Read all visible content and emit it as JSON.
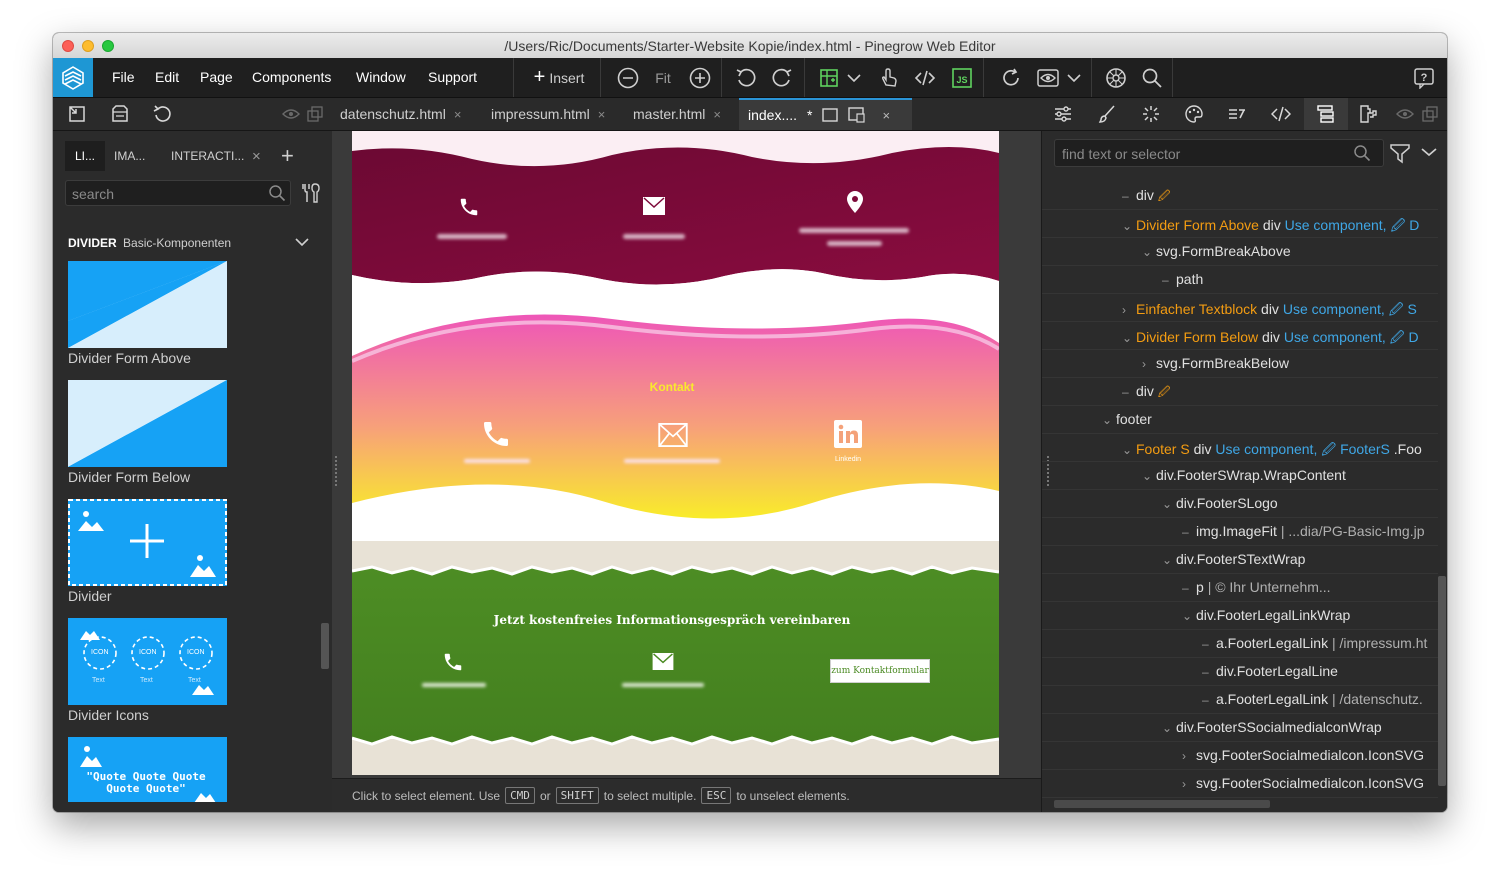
{
  "window": {
    "title": "/Users/Ric/Documents/Starter-Website Kopie/index.html - Pinegrow Web Editor"
  },
  "menu": {
    "items": [
      "File",
      "Edit",
      "Page",
      "Components",
      "Window",
      "Support"
    ]
  },
  "toolbar": {
    "insert_label": "Insert",
    "fit_label": "Fit"
  },
  "tabs": [
    {
      "label": "datenschutz.html",
      "close": "×"
    },
    {
      "label": "impressum.html",
      "close": "×"
    },
    {
      "label": "master.html",
      "close": "×"
    },
    {
      "label": "index....",
      "modified": "*",
      "close": "×",
      "active": true
    }
  ],
  "left_panel": {
    "tabs": [
      "LI...",
      "IMA...",
      "INTERACTI..."
    ],
    "close_tab": "×",
    "add_tab": "+",
    "search_placeholder": "search",
    "section_title": "DIVIDER",
    "section_subtitle": "Basic-Komponenten",
    "items": [
      {
        "label": "Divider Form Above"
      },
      {
        "label": "Divider Form Below"
      },
      {
        "label": "Divider"
      },
      {
        "label": "Divider Icons",
        "icon_text": "ICON",
        "icon_caption": "Text"
      },
      {
        "label": "\"Quote Quote Quote Quote Quote\""
      }
    ]
  },
  "canvas": {
    "section2_title": "Kontakt",
    "section2_linkedin_caption": "Linkedin",
    "section3_heading": "Jetzt kostenfreies Informationsgespräch vereinbaren",
    "section3_button": "zum Kontaktformular",
    "colors": {
      "maroon": "#7d0a3a",
      "pink": "#f06ab4",
      "yellow": "#f9e92e",
      "green": "#4a8a22",
      "paper": "#e8e2d6"
    }
  },
  "statusbar": {
    "part1": "Click to select element. Use",
    "key1": "CMD",
    "part2": "or",
    "key2": "SHIFT",
    "part3": "to select multiple.",
    "key3": "ESC",
    "part4": "to unselect elements."
  },
  "right_panel": {
    "search_placeholder": "find text or selector",
    "tree": [
      {
        "chev": "–",
        "name": "div",
        "pencil": "🖉"
      },
      {
        "chev": "⌄",
        "comp": "Divider Form Above",
        "name": "div",
        "action": "Use component,",
        "tail": "D"
      },
      {
        "chev": "⌄",
        "name": "svg.FormBreakAbove"
      },
      {
        "chev": "–",
        "name": "path"
      },
      {
        "chev": "›",
        "comp": "Einfacher Textblock",
        "name": "div",
        "action": "Use component,",
        "tail": "S"
      },
      {
        "chev": "⌄",
        "comp": "Divider Form Below",
        "name": "div",
        "action": "Use component,",
        "tail": "D"
      },
      {
        "chev": "›",
        "name": "svg.FormBreakBelow"
      },
      {
        "chev": "–",
        "name": "div",
        "pencil": "🖉"
      },
      {
        "chev": "⌄",
        "name": "footer"
      },
      {
        "chev": "⌄",
        "comp": "Footer S",
        "name": "div",
        "action": "Use component,",
        "tail2": "FooterS",
        "tail3": ".Foo"
      },
      {
        "chev": "⌄",
        "name": "div.FooterSWrap.WrapContent"
      },
      {
        "chev": "⌄",
        "name": "div.FooterSLogo"
      },
      {
        "chev": "–",
        "name": "img.ImageFit",
        "extra": "| ...dia/PG-Basic-Img.jp"
      },
      {
        "chev": "⌄",
        "name": "div.FooterSTextWrap"
      },
      {
        "chev": "–",
        "name": "p",
        "extra": "| © Ihr Unternehm..."
      },
      {
        "chev": "⌄",
        "name": "div.FooterLegalLinkWrap"
      },
      {
        "chev": "–",
        "name": "a.FooterLegalLink",
        "extra": "| /impressum.ht"
      },
      {
        "chev": "–",
        "name": "div.FooterLegalLine"
      },
      {
        "chev": "–",
        "name": "a.FooterLegalLink",
        "extra": "| /datenschutz."
      },
      {
        "chev": "⌄",
        "name": "div.FooterSSocialmedialconWrap"
      },
      {
        "chev": "›",
        "name": "svg.FooterSocialmedialcon.IconSVG"
      },
      {
        "chev": "›",
        "name": "svg.FooterSocialmedialcon.IconSVG"
      }
    ]
  }
}
